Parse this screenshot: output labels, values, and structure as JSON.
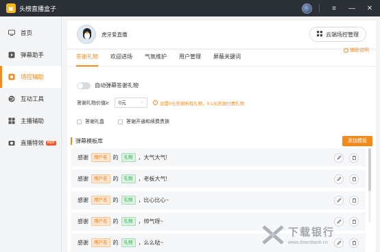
{
  "window": {
    "title": "头榜直播盒子",
    "menu_icon": "hamburger-icon",
    "minimize_icon": "minimize-icon",
    "close_icon": "close-icon"
  },
  "sidebar": {
    "items": [
      {
        "label": "首页",
        "icon": "monitor-icon",
        "active": false
      },
      {
        "label": "弹幕助手",
        "icon": "play-icon",
        "active": false
      },
      {
        "label": "场控辅助",
        "icon": "control-icon",
        "active": true
      },
      {
        "label": "互动工具",
        "icon": "globe-icon",
        "active": false
      },
      {
        "label": "主播辅助",
        "icon": "grid-icon",
        "active": false
      },
      {
        "label": "直播特效",
        "icon": "camera-icon",
        "active": false,
        "badge": "HOT"
      }
    ]
  },
  "profile": {
    "nickname": "虎牙爱直播",
    "cloud_button": "云端场控管理"
  },
  "tabs": [
    {
      "label": "答谢礼物",
      "active": true
    },
    {
      "label": "欢迎进场",
      "active": false
    },
    {
      "label": "气氛维护",
      "active": false
    },
    {
      "label": "用户管理",
      "active": false
    },
    {
      "label": "屏蔽关键词",
      "active": false
    }
  ],
  "help_link": "辅助说明",
  "auto_thanks": {
    "label": "自动弹幕答谢礼物",
    "enabled": false
  },
  "gift_value": {
    "label": "答谢礼物价值≥:",
    "selected": "0元",
    "tip": "设置0元答谢所有礼物，0.1元答谢付费礼物"
  },
  "checkboxes": [
    {
      "label": "答谢礼盒",
      "checked": false
    },
    {
      "label": "答谢开通和续费贵族",
      "checked": false
    }
  ],
  "templates_section": {
    "title": "弹幕模板库",
    "add_button": "添加模板"
  },
  "templates": [
    {
      "prefix": "感谢",
      "user_chip": "用户名",
      "mid": "的",
      "gift_chip": "礼物",
      "suffix": "，大气大气!"
    },
    {
      "prefix": "感谢",
      "user_chip": "用户名",
      "mid": "的",
      "gift_chip": "礼物",
      "suffix": "，老板大气!"
    },
    {
      "prefix": "感谢",
      "user_chip": "用户名",
      "mid": "的",
      "gift_chip": "礼物",
      "suffix": "，比心比心~"
    },
    {
      "prefix": "感谢",
      "user_chip": "用户名",
      "mid": "的",
      "gift_chip": "礼物",
      "suffix": "，帅气呀~"
    },
    {
      "prefix": "感谢",
      "user_chip": "用户名",
      "mid": "的",
      "gift_chip": "礼物",
      "suffix": "，么么哒~"
    }
  ],
  "watermark": {
    "name": "下载银行",
    "url": "www.downbank.cn"
  }
}
